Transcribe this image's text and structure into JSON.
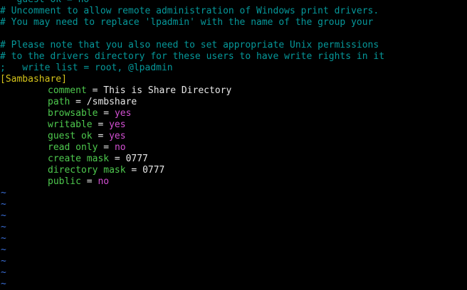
{
  "editor": {
    "lines": [
      {
        "kind": "comment",
        "text": "   guest ok = no"
      },
      {
        "kind": "comment",
        "text": "# Uncomment to allow remote administration of Windows print drivers."
      },
      {
        "kind": "comment",
        "text": "# You may need to replace 'lpadmin' with the name of the group your"
      },
      {
        "kind": "blank",
        "text": ""
      },
      {
        "kind": "comment",
        "text": "# Please note that you also need to set appropriate Unix permissions"
      },
      {
        "kind": "comment",
        "text": "# to the drivers directory for these users to have write rights in it"
      },
      {
        "kind": "comment",
        "text": ";   write list = root, @lpadmin"
      }
    ],
    "section_header": "[Sambashare]",
    "params": [
      {
        "key": "comment",
        "sep": " = ",
        "value": "This is Share Directory",
        "value_color": "white"
      },
      {
        "key": "path",
        "sep": " = ",
        "value": "/smbshare",
        "value_color": "white"
      },
      {
        "key": "browsable",
        "sep": " = ",
        "value": "yes",
        "value_color": "magenta"
      },
      {
        "key": "writable",
        "sep": " = ",
        "value": "yes",
        "value_color": "magenta"
      },
      {
        "key": "guest ok",
        "sep": " = ",
        "value": "yes",
        "value_color": "magenta"
      },
      {
        "key": "read only",
        "sep": " = ",
        "value": "no",
        "value_color": "magenta"
      },
      {
        "key": "create mask",
        "sep": " = ",
        "value": "0777",
        "value_color": "white"
      },
      {
        "key": "directory mask",
        "sep": " = ",
        "value": "0777",
        "value_color": "white"
      },
      {
        "key": "public",
        "sep": " = ",
        "value": "no",
        "value_color": "magenta"
      }
    ],
    "empty_line_marker": "~",
    "empty_line_count": 9
  },
  "colors": {
    "background": "#000000",
    "comment": "#06989a",
    "key": "#4ec94e",
    "boolean": "#d34fd3",
    "section": "#d4c31a",
    "plain": "#e8e8e8",
    "tilde": "#3a6fd8"
  }
}
